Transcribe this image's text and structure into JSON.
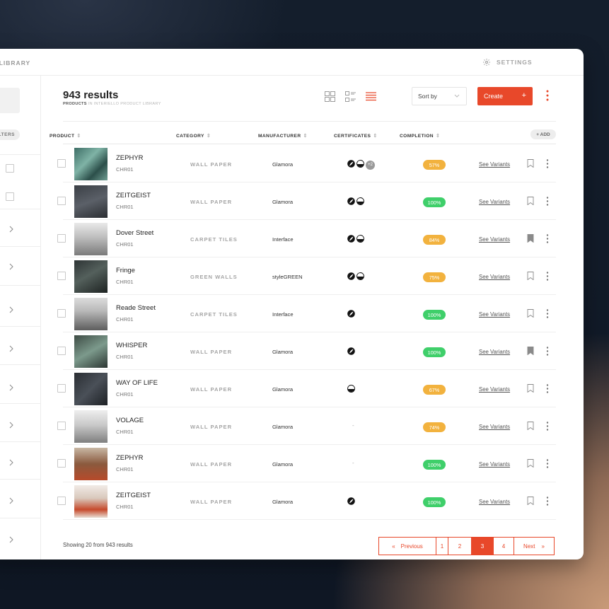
{
  "topbar": {
    "library_label": "/ LIBRARY",
    "settings_label": "SETTINGS"
  },
  "sidebar": {
    "filters_label": "LTERS"
  },
  "header": {
    "results_title": "943 results",
    "subtitle_prefix": "PRODUCTS",
    "subtitle_rest": " IN INTERIELLO PRODUCT LIBRARY",
    "sort_label": "Sort by",
    "create_label": "Create",
    "create_plus": "+"
  },
  "columns": {
    "product": "PRODUCT",
    "category": "CATEGORY",
    "manufacturer": "MANUFACTURER",
    "certificates": "CERTIFICATES",
    "completion": "COMPLETION",
    "add": "+ ADD"
  },
  "rows": [
    {
      "name": "ZEPHYR",
      "code": "CHR01",
      "category": "WALL PAPER",
      "manufacturer": "Glamora",
      "certs": [
        "leaf",
        "half",
        "+2"
      ],
      "completion": "57%",
      "status": "orange",
      "variants": "See Variants",
      "bookmarked": false
    },
    {
      "name": "ZEITGEIST",
      "code": "CHR01",
      "category": "WALL PAPER",
      "manufacturer": "Glamora",
      "certs": [
        "leaf",
        "half"
      ],
      "completion": "100%",
      "status": "green",
      "variants": "See Variants",
      "bookmarked": false
    },
    {
      "name": "Dover Street",
      "code": "CHR01",
      "category": "CARPET TILES",
      "manufacturer": "Interface",
      "certs": [
        "leaf",
        "half"
      ],
      "completion": "84%",
      "status": "orange",
      "variants": "See Variants",
      "bookmarked": true
    },
    {
      "name": "Fringe",
      "code": "CHR01",
      "category": "GREEN WALLS",
      "manufacturer": "styleGREEN",
      "certs": [
        "leaf",
        "half"
      ],
      "completion": "75%",
      "status": "orange",
      "variants": "See Variants",
      "bookmarked": false
    },
    {
      "name": "Reade Street",
      "code": "CHR01",
      "category": "CARPET TILES",
      "manufacturer": "Interface",
      "certs": [
        "leaf"
      ],
      "completion": "100%",
      "status": "green",
      "variants": "See Variants",
      "bookmarked": false
    },
    {
      "name": "WHISPER",
      "code": "CHR01",
      "category": "WALL PAPER",
      "manufacturer": "Glamora",
      "certs": [
        "leaf"
      ],
      "completion": "100%",
      "status": "green",
      "variants": "See Variants",
      "bookmarked": true
    },
    {
      "name": "WAY OF LIFE",
      "code": "CHR01",
      "category": "WALL PAPER",
      "manufacturer": "Glamora",
      "certs": [
        "half"
      ],
      "completion": "67%",
      "status": "orange",
      "variants": "See Variants",
      "bookmarked": false
    },
    {
      "name": "VOLAGE",
      "code": "CHR01",
      "category": "WALL PAPER",
      "manufacturer": "Glamora",
      "certs": [],
      "completion": "74%",
      "status": "orange",
      "variants": "See Variants",
      "bookmarked": false
    },
    {
      "name": "ZEPHYR",
      "code": "CHR01",
      "category": "WALL PAPER",
      "manufacturer": "Glamora",
      "certs": [],
      "completion": "100%",
      "status": "green",
      "variants": "See Variants",
      "bookmarked": false
    },
    {
      "name": "ZEITGEIST",
      "code": "CHR01",
      "category": "WALL PAPER",
      "manufacturer": "Glamora",
      "certs": [
        "leaf"
      ],
      "completion": "100%",
      "status": "green",
      "variants": "See Variants",
      "bookmarked": false
    }
  ],
  "empty_cert": "-",
  "footer": {
    "showing": "Showing 20 from 943 results",
    "previous": "Previous",
    "next": "Next",
    "pages": [
      "1",
      "2",
      "3",
      "4"
    ],
    "active_page": "3"
  },
  "colors": {
    "accent": "#e8482a",
    "orange": "#f2b23e",
    "green": "#3fcf6a"
  }
}
